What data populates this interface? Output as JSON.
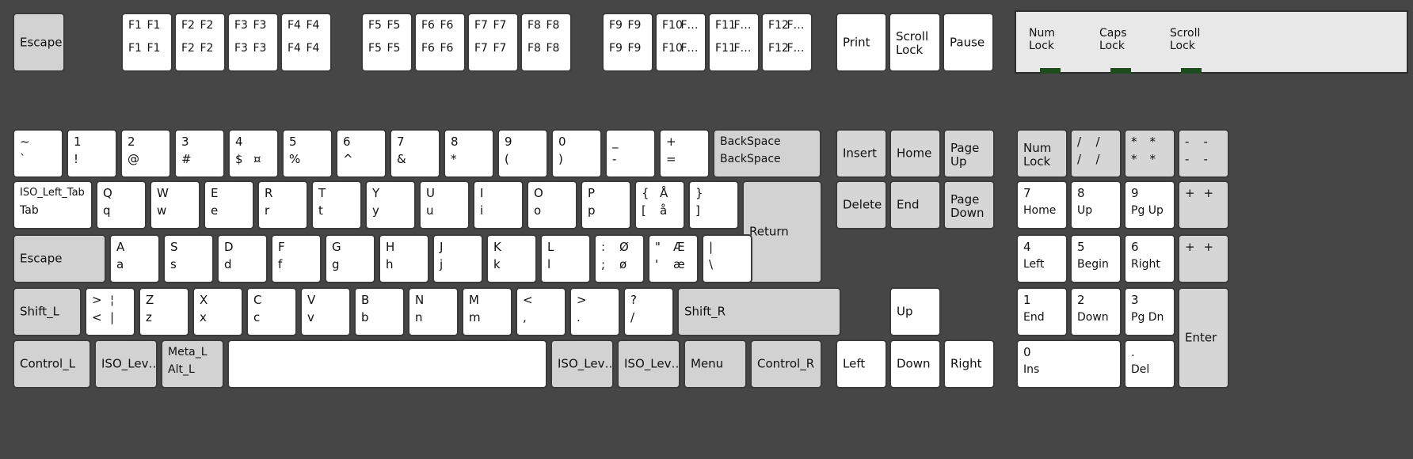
{
  "window": {
    "background_color": "#464646",
    "key_face_color": "#ffffff",
    "modifier_key_color": "#d2d2d2",
    "keypad_key_color": "#d6d6d6",
    "key_border_color": "#3b3b3b",
    "text_color": "#111111"
  },
  "led_panel": {
    "background_color": "#e8e8e8",
    "lamp_color": "#1d4d1d",
    "indicators": [
      {
        "name": "num-lock",
        "label": "Num\nLock"
      },
      {
        "name": "caps-lock",
        "label": "Caps\nLock"
      },
      {
        "name": "scroll-lock",
        "label": "Scroll\nLock"
      }
    ]
  },
  "keys": {
    "escape_top": "Escape",
    "function_row": [
      {
        "name": "f1",
        "tl": "F1",
        "tr": "F1",
        "bl": "F1",
        "br": "F1"
      },
      {
        "name": "f2",
        "tl": "F2",
        "tr": "F2",
        "bl": "F2",
        "br": "F2"
      },
      {
        "name": "f3",
        "tl": "F3",
        "tr": "F3",
        "bl": "F3",
        "br": "F3"
      },
      {
        "name": "f4",
        "tl": "F4",
        "tr": "F4",
        "bl": "F4",
        "br": "F4"
      },
      {
        "name": "f5",
        "tl": "F5",
        "tr": "F5",
        "bl": "F5",
        "br": "F5"
      },
      {
        "name": "f6",
        "tl": "F6",
        "tr": "F6",
        "bl": "F6",
        "br": "F6"
      },
      {
        "name": "f7",
        "tl": "F7",
        "tr": "F7",
        "bl": "F7",
        "br": "F7"
      },
      {
        "name": "f8",
        "tl": "F8",
        "tr": "F8",
        "bl": "F8",
        "br": "F8"
      },
      {
        "name": "f9",
        "tl": "F9",
        "tr": "F9",
        "bl": "F9",
        "br": "F9"
      },
      {
        "name": "f10",
        "tl": "F10",
        "tr": "F…",
        "bl": "F10",
        "br": "F…"
      },
      {
        "name": "f11",
        "tl": "F11",
        "tr": "F…",
        "bl": "F11",
        "br": "F…"
      },
      {
        "name": "f12",
        "tl": "F12",
        "tr": "F…",
        "bl": "F12",
        "br": "F…"
      }
    ],
    "print": "Print",
    "scroll_lock": "Scroll\nLock",
    "pause": "Pause",
    "number_row": [
      {
        "name": "grave",
        "tl": "~",
        "bl": "`"
      },
      {
        "name": "digit-1",
        "tl": "1",
        "bl": "!"
      },
      {
        "name": "digit-2",
        "tl": "2",
        "bl": "@"
      },
      {
        "name": "digit-3",
        "tl": "3",
        "bl": "#"
      },
      {
        "name": "digit-4",
        "tl": "4",
        "bl": "$",
        "tr2": "¤"
      },
      {
        "name": "digit-5",
        "tl": "5",
        "bl": "%"
      },
      {
        "name": "digit-6",
        "tl": "6",
        "bl": "^"
      },
      {
        "name": "digit-7",
        "tl": "7",
        "bl": "&"
      },
      {
        "name": "digit-8",
        "tl": "8",
        "bl": "*"
      },
      {
        "name": "digit-9",
        "tl": "9",
        "bl": "("
      },
      {
        "name": "digit-0",
        "tl": "0",
        "bl": ")"
      },
      {
        "name": "minus",
        "tl": "_",
        "bl": "-"
      },
      {
        "name": "equal",
        "tl": "+",
        "bl": "="
      }
    ],
    "backspace": {
      "top": "BackSpace",
      "bottom": "BackSpace"
    },
    "tab_key": {
      "top": "ISO_Left_Tab",
      "bottom": "Tab"
    },
    "qwerty_row": [
      {
        "name": "q",
        "tl": "Q",
        "bl": "q"
      },
      {
        "name": "w",
        "tl": "W",
        "bl": "w"
      },
      {
        "name": "e",
        "tl": "E",
        "bl": "e"
      },
      {
        "name": "r",
        "tl": "R",
        "bl": "r"
      },
      {
        "name": "t",
        "tl": "T",
        "bl": "t"
      },
      {
        "name": "y",
        "tl": "Y",
        "bl": "y"
      },
      {
        "name": "u",
        "tl": "U",
        "bl": "u"
      },
      {
        "name": "i",
        "tl": "I",
        "bl": "i"
      },
      {
        "name": "o",
        "tl": "O",
        "bl": "o"
      },
      {
        "name": "p",
        "tl": "P",
        "bl": "p"
      },
      {
        "name": "bracketleft",
        "tl": "{",
        "tr": "Å",
        "bl": "[",
        "br": "å"
      },
      {
        "name": "bracketright",
        "tl": "}",
        "bl": "]"
      }
    ],
    "return": "Return",
    "caps_escape": "Escape",
    "home_row": [
      {
        "name": "a",
        "tl": "A",
        "bl": "a"
      },
      {
        "name": "s",
        "tl": "S",
        "bl": "s"
      },
      {
        "name": "d",
        "tl": "D",
        "bl": "d"
      },
      {
        "name": "f",
        "tl": "F",
        "bl": "f"
      },
      {
        "name": "g",
        "tl": "G",
        "bl": "g"
      },
      {
        "name": "h",
        "tl": "H",
        "bl": "h"
      },
      {
        "name": "j",
        "tl": "J",
        "bl": "j"
      },
      {
        "name": "k",
        "tl": "K",
        "bl": "k"
      },
      {
        "name": "l",
        "tl": "L",
        "bl": "l"
      },
      {
        "name": "semicolon",
        "tl": ":",
        "tr": "Ø",
        "bl": ";",
        "br": "ø"
      },
      {
        "name": "apostrophe",
        "tl": "\"",
        "tr": "Æ",
        "bl": "'",
        "br": "æ"
      },
      {
        "name": "backslash",
        "tl": "|",
        "bl": "\\"
      }
    ],
    "shift_l": "Shift_L",
    "shift_row": [
      {
        "name": "less-greater",
        "tl": ">",
        "tr": "¦",
        "bl": "<",
        "br": "|"
      },
      {
        "name": "z",
        "tl": "Z",
        "bl": "z"
      },
      {
        "name": "x",
        "tl": "X",
        "bl": "x"
      },
      {
        "name": "c",
        "tl": "C",
        "bl": "c"
      },
      {
        "name": "v",
        "tl": "V",
        "bl": "v"
      },
      {
        "name": "b",
        "tl": "B",
        "bl": "b"
      },
      {
        "name": "n",
        "tl": "N",
        "bl": "n"
      },
      {
        "name": "m",
        "tl": "M",
        "bl": "m"
      },
      {
        "name": "comma",
        "tl": "<",
        "bl": ","
      },
      {
        "name": "period",
        "tl": ">",
        "bl": "."
      },
      {
        "name": "slash",
        "tl": "?",
        "bl": "/"
      }
    ],
    "shift_r": "Shift_R",
    "control_l": "Control_L",
    "iso_level_left": "ISO_Lev…",
    "meta_alt": {
      "top": "Meta_L",
      "bottom": "Alt_L"
    },
    "space": "",
    "iso_level_right1": "ISO_Lev…",
    "iso_level_right2": "ISO_Lev…",
    "menu": "Menu",
    "control_r": "Control_R"
  },
  "nav_cluster": {
    "insert": "Insert",
    "home": "Home",
    "page_up": "Page\nUp",
    "delete": "Delete",
    "end": "End",
    "page_down": "Page\nDown",
    "up": "Up",
    "left": "Left",
    "down": "Down",
    "right": "Right"
  },
  "numpad": {
    "num_lock": "Num\nLock",
    "divide": {
      "tl": "/",
      "tr": "/",
      "bl": "/",
      "br": "/"
    },
    "multiply": {
      "tl": "*",
      "tr": "*",
      "bl": "*",
      "br": "*"
    },
    "subtract": {
      "tl": "-",
      "tr": "-",
      "bl": "-",
      "br": "-"
    },
    "kp7": {
      "top": "7",
      "bottom": "Home"
    },
    "kp8": {
      "top": "8",
      "bottom": "Up"
    },
    "kp9": {
      "top": "9",
      "bottom": "Pg Up"
    },
    "add_upper": {
      "tl": "+",
      "tr": "+"
    },
    "kp4": {
      "top": "4",
      "bottom": "Left"
    },
    "kp5": {
      "top": "5",
      "bottom": "Begin"
    },
    "kp6": {
      "top": "6",
      "bottom": "Right"
    },
    "add_lower": {
      "tl": "+",
      "tr": "+"
    },
    "kp1": {
      "top": "1",
      "bottom": "End"
    },
    "kp2": {
      "top": "2",
      "bottom": "Down"
    },
    "kp3": {
      "top": "3",
      "bottom": "Pg Dn"
    },
    "kp0": {
      "top": "0",
      "bottom": "Ins"
    },
    "kp_decimal": {
      "top": ".",
      "bottom": "Del"
    },
    "enter": "Enter"
  }
}
